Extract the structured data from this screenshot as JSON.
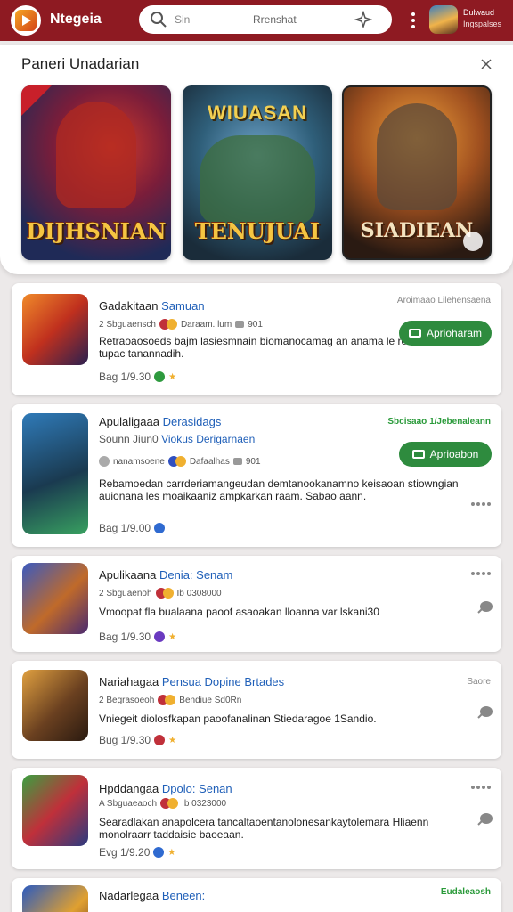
{
  "header": {
    "brand": "Ntegeia",
    "search_placeholder": "Sin",
    "search_hint": "Rrenshat",
    "user_name": "Dulwaud",
    "user_sub": "Ingspalses",
    "colors": {
      "bar": "#8e1a22",
      "accent_green": "#2e8b3e",
      "link_blue": "#1f5fb8"
    }
  },
  "featured": {
    "title": "Paneri Unadarian",
    "cards": [
      {
        "name": "DIJHSNIAN",
        "sub": ""
      },
      {
        "name": "TENUJUAI",
        "sub": "WIUASAN"
      },
      {
        "name": "SIADIEAN",
        "sub": ""
      }
    ]
  },
  "apps": [
    {
      "title": "Gadakitaan",
      "title_accent": "Samuan",
      "sub": "",
      "meta_left": "2 Sbguaensch",
      "meta_mid": "Daraam. lum",
      "meta_right": "901",
      "desc": "Retraoaosoeds bajm lasiesmnain biomanocamag an anama le reanaic keran tupac tanannadih.",
      "rating": "Bag 1/9.30",
      "right_label": "Aroimaao Lilehensaena",
      "button": "Aprioharam"
    },
    {
      "title": "Apulaligaaa",
      "title_accent": "Derasidags",
      "sub_muted": "Sounn Jiun0",
      "sub": "Viokus Derigarnaen",
      "meta_left": "nanamsoene",
      "meta_mid": "Dafaalhas",
      "meta_right": "901",
      "desc": "Rebamoedan carrderiamangeudan demtanookanamno keisaoan stiowngian auionana les moaikaaniz ampkarkan raam. Sabao aann.",
      "rating": "Bag 1/9.00",
      "right_label": "Sbcisaao 1/Jebenaleann",
      "button": "Aprioabon"
    },
    {
      "title": "Apulikaana",
      "title_accent": "Denia: Senam",
      "sub": "",
      "meta_left": "2 Sbguaenoh",
      "meta_mid": "Ib 0308000",
      "meta_right": "",
      "desc": "Vmoopat fla bualaana paoof asaoakan lloanna var lskani30",
      "rating": "Bag 1/9.30",
      "right_label": "",
      "button": ""
    },
    {
      "title": "Nariahagaa",
      "title_accent": "Pensua Dopine Brtades",
      "sub": "",
      "meta_left": "2 Begrasoeoh",
      "meta_mid": "Bendiue Sd0Rn",
      "meta_right": "",
      "desc": "Vniegeit diolosfkapan paoofanalinan Stiedaragoe 1Sandio.",
      "rating": "Bug 1/9.30",
      "right_label": "Saore",
      "button": ""
    },
    {
      "title": "Hpddangaa",
      "title_accent": "Dpolo: Senan",
      "sub": "",
      "meta_left": "A Sbguaeaoch",
      "meta_mid": "Ib 0323000",
      "meta_right": "",
      "desc": "Searadlakan anapolcera tancaltaoentanolonesankaytolemara Hliaenn monolraarr taddaisie baoeaan.",
      "rating": "Evg 1/9.20",
      "right_label": "",
      "button": ""
    },
    {
      "title": "Nadarlegaa",
      "title_accent": "Beneen:",
      "sub": "",
      "meta_left": "",
      "meta_mid": "",
      "meta_right": "",
      "desc": "",
      "rating": "",
      "right_label": "Eudaleaosh",
      "button": ""
    }
  ]
}
